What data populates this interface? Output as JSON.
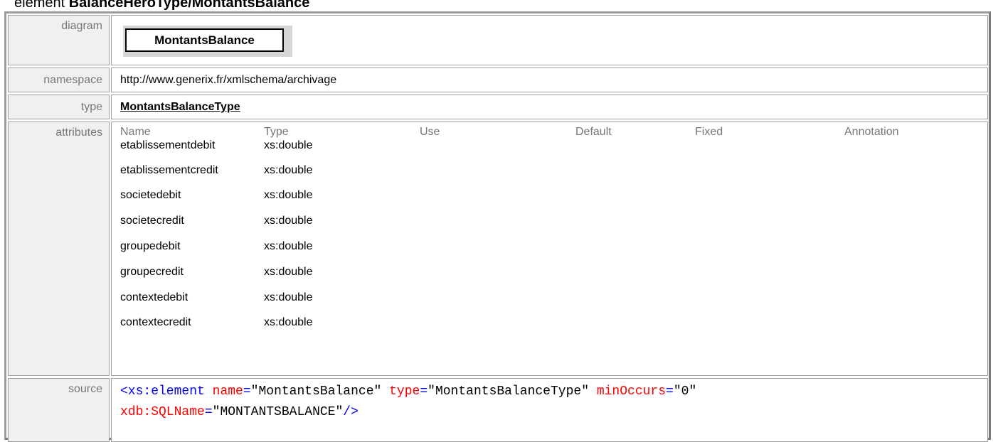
{
  "heading": {
    "prefix": "element",
    "name": "BalanceHeroType/MontantsBalance"
  },
  "rows": {
    "diagram": {
      "label": "diagram",
      "box_text": "MontantsBalance"
    },
    "namespace": {
      "label": "namespace",
      "value": "http://www.generix.fr/xmlschema/archivage"
    },
    "type": {
      "label": "type",
      "value": "MontantsBalanceType"
    },
    "attributes": {
      "label": "attributes",
      "headers": [
        "Name",
        "Type",
        "Use",
        "Default",
        "Fixed",
        "Annotation"
      ],
      "items": [
        {
          "name": "etablissementdebit",
          "type": "xs:double"
        },
        {
          "name": "etablissementcredit",
          "type": "xs:double"
        },
        {
          "name": "societedebit",
          "type": "xs:double"
        },
        {
          "name": "societecredit",
          "type": "xs:double"
        },
        {
          "name": "groupedebit",
          "type": "xs:double"
        },
        {
          "name": "groupecredit",
          "type": "xs:double"
        },
        {
          "name": "contextedebit",
          "type": "xs:double"
        },
        {
          "name": "contextecredit",
          "type": "xs:double"
        }
      ]
    },
    "source": {
      "label": "source",
      "line1": {
        "open": "<xs:element",
        "attr1": "name",
        "eq1": "=",
        "val1": "\"MontantsBalance\"",
        "attr2": "type",
        "eq2": "=",
        "val2": "\"MontantsBalanceType\"",
        "attr3": "minOccurs",
        "eq3": "=",
        "val3": "\"0\""
      },
      "line2": {
        "attr4": "xdb:SQLName",
        "eq4": "=",
        "val4": "\"MONTANTSBALANCE\"",
        "close": "/>"
      }
    }
  }
}
